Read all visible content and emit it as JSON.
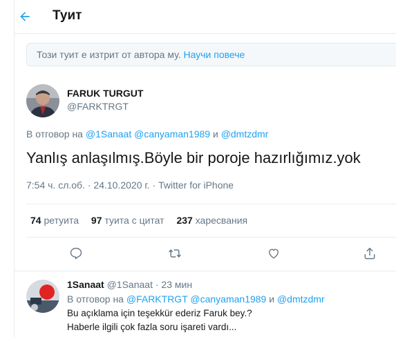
{
  "header": {
    "title": "Туит"
  },
  "notice": {
    "text": "Този туит е изтрит от автора му.",
    "link": "Научи повече"
  },
  "tweet": {
    "author_name": "FARUK TURGUT",
    "author_handle": "@FARKTRGT",
    "reply_prefix": "В отговор на",
    "reply_to_1": "@1Sanaat",
    "reply_to_2": "@canyaman1989",
    "reply_and": "и",
    "reply_to_3": "@dmtzdmr",
    "text": "Yanlış anlaşılmış.Böyle bir poroje hazırlığımız.yok",
    "time": "7:54 ч. сл.об.",
    "date": "24.10.2020 г.",
    "source": "Twitter for iPhone",
    "stats": {
      "retweets_count": "74",
      "retweets_label": "ретуита",
      "quotes_count": "97",
      "quotes_label": "туита с цитат",
      "likes_count": "237",
      "likes_label": "харесвания"
    }
  },
  "reply_tweet": {
    "author_name": "1Sanaat",
    "author_handle": "@1Sanaat",
    "time": "23 мин",
    "reply_prefix": "В отговор на",
    "reply_to_1": "@FARKTRGT",
    "reply_to_2": "@canyaman1989",
    "reply_and": "и",
    "reply_to_3": "@dmtzdmr",
    "line1": "Bu açıklama için teşekkür ederiz Faruk bey.?",
    "line2": "Haberle ilgili çok fazla soru işareti vardı..."
  },
  "colors": {
    "accent": "#1da1f2",
    "secondary_text": "#657786",
    "border": "#e6ecf0"
  },
  "icons": [
    "back-arrow-icon",
    "reply-icon",
    "retweet-icon",
    "like-icon",
    "share-icon"
  ]
}
